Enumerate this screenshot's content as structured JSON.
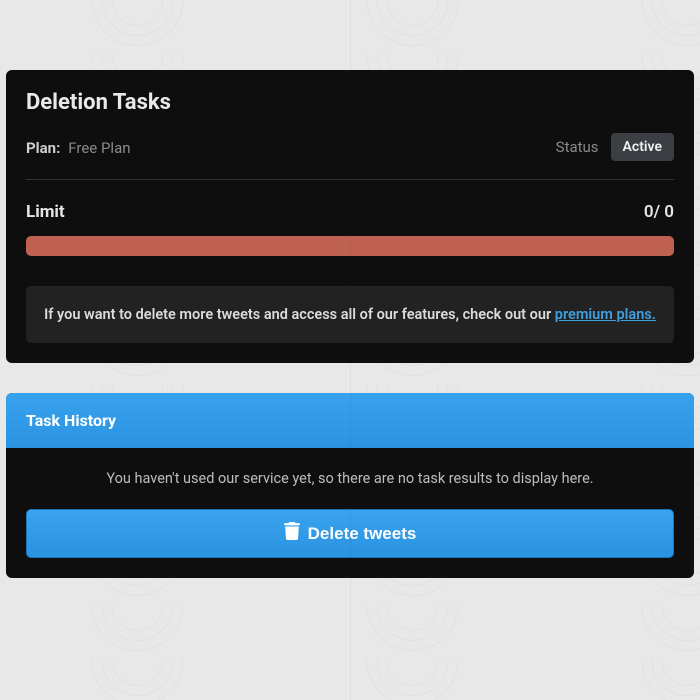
{
  "deletion": {
    "title": "Deletion Tasks",
    "plan_label": "Plan:",
    "plan_value": "Free Plan",
    "status_label": "Status",
    "status_badge": "Active",
    "limit_label": "Limit",
    "limit_value": "0/ 0",
    "upsell_prefix": "If you want to delete more tweets and access all of our features, check out our ",
    "upsell_link": "premium plans."
  },
  "history": {
    "title": "Task History",
    "empty_text": "You haven't used our service yet, so there are no task results to display here.",
    "delete_button": "Delete tweets"
  }
}
